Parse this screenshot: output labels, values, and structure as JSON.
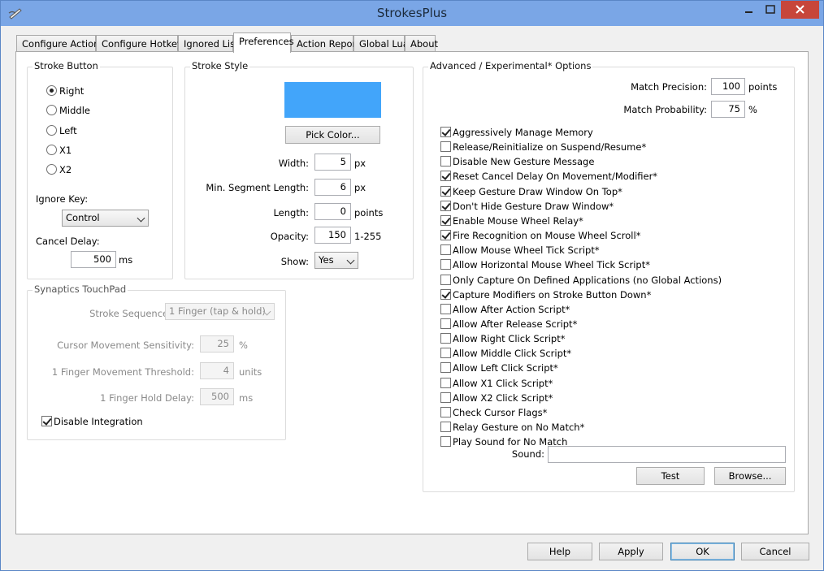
{
  "window": {
    "title": "StrokesPlus"
  },
  "tabs": [
    "Configure Actions",
    "Configure Hotkeys",
    "Ignored List",
    "Preferences",
    "Action Report",
    "Global Lua",
    "About"
  ],
  "active_tab": "Preferences",
  "stroke_button": {
    "title": "Stroke Button",
    "options": [
      "Right",
      "Middle",
      "Left",
      "X1",
      "X2"
    ],
    "selected": "Right",
    "ignore_key_label": "Ignore Key:",
    "ignore_key_value": "Control",
    "cancel_delay_label": "Cancel Delay:",
    "cancel_delay_value": "500",
    "cancel_delay_unit": "ms"
  },
  "stroke_style": {
    "title": "Stroke Style",
    "color": "#42a5fa",
    "pick_color_label": "Pick Color...",
    "width_label": "Width:",
    "width_value": "5",
    "width_unit": "px",
    "min_segment_label": "Min. Segment Length:",
    "min_segment_value": "6",
    "min_segment_unit": "px",
    "length_label": "Length:",
    "length_value": "0",
    "length_unit": "points",
    "opacity_label": "Opacity:",
    "opacity_value": "150",
    "opacity_unit": "1-255",
    "show_label": "Show:",
    "show_value": "Yes"
  },
  "touchpad": {
    "title": "Synaptics TouchPad",
    "stroke_sequence_label": "Stroke Sequence:",
    "stroke_sequence_value": "1 Finger (tap & hold)",
    "cursor_sensitivity_label": "Cursor Movement Sensitivity:",
    "cursor_sensitivity_value": "25",
    "cursor_sensitivity_unit": "%",
    "movement_threshold_label": "1 Finger Movement Threshold:",
    "movement_threshold_value": "4",
    "movement_threshold_unit": "units",
    "hold_delay_label": "1 Finger Hold Delay:",
    "hold_delay_value": "500",
    "hold_delay_unit": "ms",
    "disable_integration_label": "Disable Integration",
    "disable_integration_checked": true
  },
  "advanced": {
    "title": "Advanced / Experimental* Options",
    "match_precision_label": "Match Precision:",
    "match_precision_value": "100",
    "match_precision_unit": "points",
    "match_probability_label": "Match Probability:",
    "match_probability_value": "75",
    "match_probability_unit": "%",
    "options": [
      {
        "label": "Aggressively Manage Memory",
        "checked": true
      },
      {
        "label": "Release/Reinitialize on Suspend/Resume*",
        "checked": false
      },
      {
        "label": "Disable New Gesture Message",
        "checked": false
      },
      {
        "label": "Reset Cancel Delay On Movement/Modifier*",
        "checked": true
      },
      {
        "label": "Keep Gesture Draw Window On Top*",
        "checked": true
      },
      {
        "label": "Don't Hide Gesture Draw Window*",
        "checked": true
      },
      {
        "label": "Enable Mouse Wheel Relay*",
        "checked": true
      },
      {
        "label": "Fire Recognition on Mouse Wheel Scroll*",
        "checked": true
      },
      {
        "label": "Allow Mouse Wheel Tick Script*",
        "checked": false
      },
      {
        "label": "Allow Horizontal Mouse Wheel Tick Script*",
        "checked": false
      },
      {
        "label": "Only Capture On Defined Applications (no Global Actions)",
        "checked": false
      },
      {
        "label": "Capture Modifiers on Stroke Button Down*",
        "checked": true
      },
      {
        "label": "Allow After Action Script*",
        "checked": false
      },
      {
        "label": "Allow After Release Script*",
        "checked": false
      },
      {
        "label": "Allow Right Click Script*",
        "checked": false
      },
      {
        "label": "Allow Middle Click Script*",
        "checked": false
      },
      {
        "label": "Allow Left Click Script*",
        "checked": false
      },
      {
        "label": "Allow X1 Click Script*",
        "checked": false
      },
      {
        "label": "Allow X2 Click Script*",
        "checked": false
      },
      {
        "label": "Check Cursor Flags*",
        "checked": false
      },
      {
        "label": "Relay Gesture on No Match*",
        "checked": false
      },
      {
        "label": "Play Sound for No Match",
        "checked": false
      }
    ],
    "sound_label": "Sound:",
    "sound_value": "",
    "test_label": "Test",
    "browse_label": "Browse..."
  },
  "footer": {
    "help": "Help",
    "apply": "Apply",
    "ok": "OK",
    "cancel": "Cancel"
  }
}
